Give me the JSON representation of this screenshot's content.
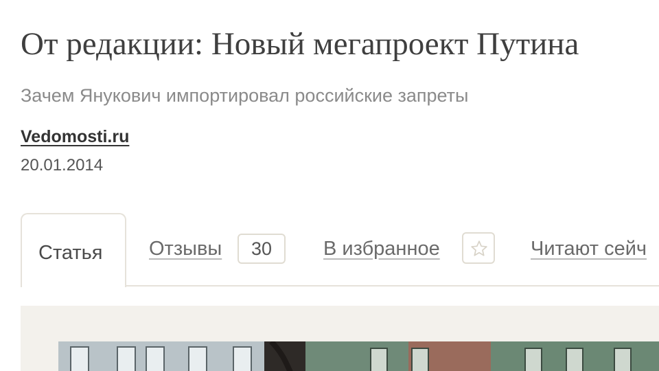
{
  "article": {
    "headline": "От редакции: Новый мегапроект Путина",
    "subtitle": "Зачем Янукович импортировал российские запреты",
    "source": "Vedomosti.ru",
    "date": "20.01.2014"
  },
  "tabs": {
    "article_label": "Статья",
    "reviews_label": "Отзывы",
    "reviews_count": "30",
    "favorite_label": "В избранное",
    "reading_now_label": "Читают сейч"
  },
  "icons": {
    "favorite": "star-icon"
  },
  "colors": {
    "panel_background": "#f3f1ec",
    "tab_border": "#e6e2da"
  }
}
